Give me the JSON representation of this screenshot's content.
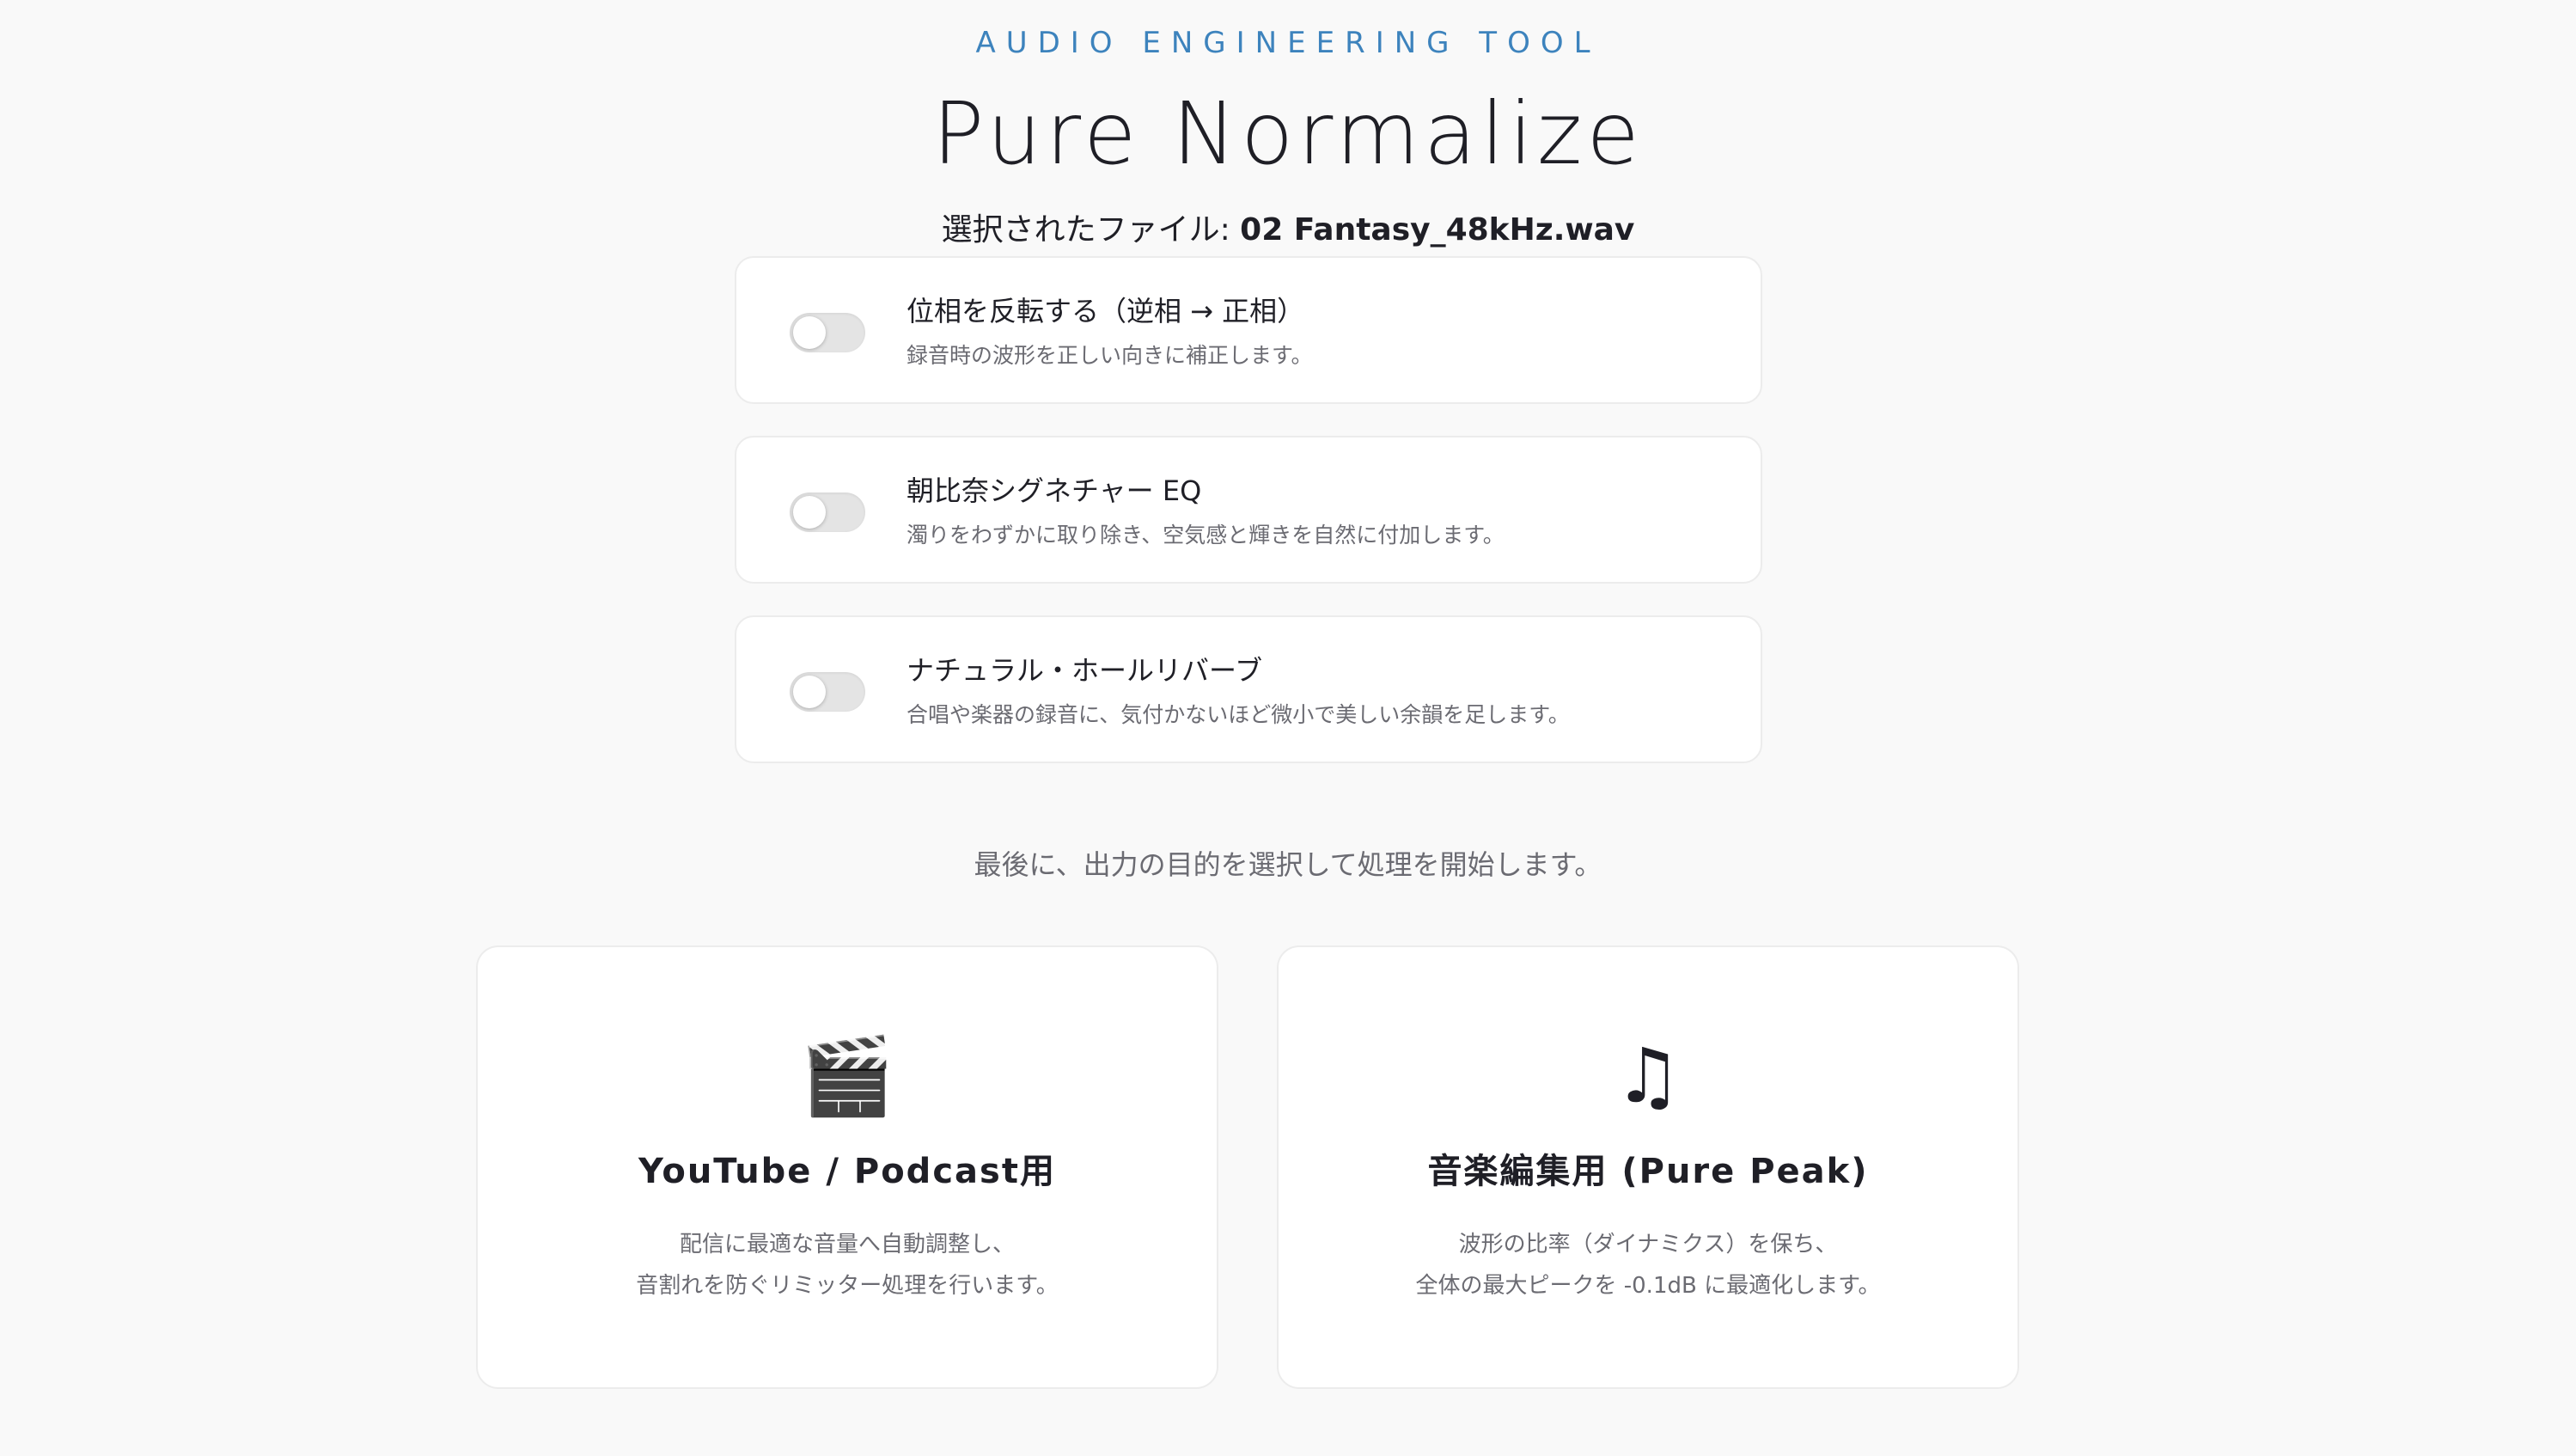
{
  "header": {
    "eyebrow": "AUDIO ENGINEERING TOOL",
    "title": "Pure Normalize",
    "file_label": "選択されたファイル: ",
    "file_name": "02 Fantasy_48kHz.wav"
  },
  "options": [
    {
      "title": "位相を反転する（逆相 → 正相）",
      "description": "録音時の波形を正しい向きに補正します。",
      "enabled": false
    },
    {
      "title": "朝比奈シグネチャー EQ",
      "description": "濁りをわずかに取り除き、空気感と輝きを自然に付加します。",
      "enabled": false
    },
    {
      "title": "ナチュラル・ホールリバーブ",
      "description": "合唱や楽器の録音に、気付かないほど微小で美しい余韻を足します。",
      "enabled": false
    }
  ],
  "prompt": "最後に、出力の目的を選択して処理を開始します。",
  "modes": [
    {
      "icon": "clapperboard-icon",
      "icon_glyph": "🎬",
      "title": "YouTube / Podcast用",
      "desc_line1": "配信に最適な音量へ自動調整し、",
      "desc_line2": "音割れを防ぐリミッター処理を行います。"
    },
    {
      "icon": "music-notes-icon",
      "icon_glyph": "♫",
      "title": "音楽編集用 (Pure Peak)",
      "desc_line1": "波形の比率（ダイナミクス）を保ち、",
      "desc_line2": "全体の最大ピークを -0.1dB に最適化します。"
    }
  ],
  "colors": {
    "accent": "#3d83bd",
    "background": "#f9f9f9",
    "card": "#ffffff",
    "toggle_off": "#e4e4e4"
  }
}
